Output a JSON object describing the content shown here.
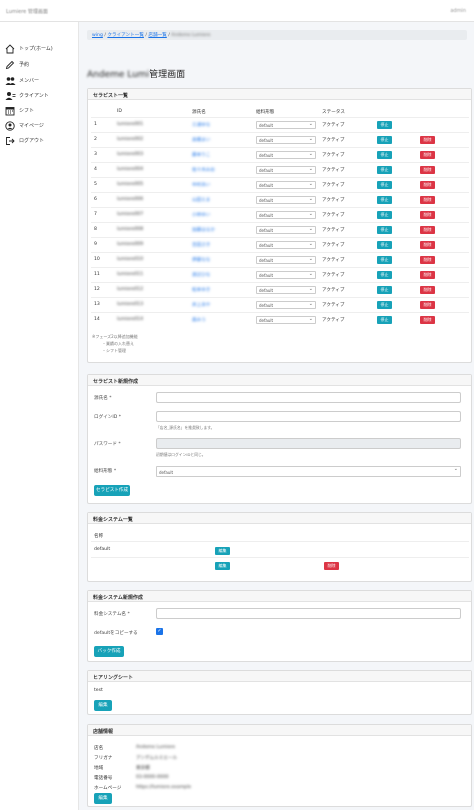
{
  "header": {
    "brand": "Lumiere 管理画面",
    "user": "admin"
  },
  "sidebar": [
    {
      "label": "トップ(ホーム)",
      "icon": "home-icon"
    },
    {
      "label": "予約",
      "icon": "pencil-icon"
    },
    {
      "label": "メンバー",
      "icon": "users-icon"
    },
    {
      "label": "クライアント",
      "icon": "user-card-icon"
    },
    {
      "label": "シフト",
      "icon": "calendar-icon"
    },
    {
      "label": "マイページ",
      "icon": "user-circle-icon"
    },
    {
      "label": "ログアウト",
      "icon": "logout-icon"
    }
  ],
  "breadcrumb": [
    "wing",
    "クライアント一覧",
    "店舗一覧",
    "Andeme Lumiere"
  ],
  "page": {
    "title_blur": "Andeme Lumi",
    "title": "管理画面"
  },
  "therapists": {
    "title": "セラピスト一覧",
    "columns": [
      "ID",
      "源氏名",
      "給料形態",
      "ステータス"
    ],
    "rows": [
      {
        "no": "1",
        "id": "lumiere001",
        "name": "三浦ゆな",
        "pay": "default",
        "status": "アクティブ",
        "has_delete": false
      },
      {
        "no": "2",
        "id": "lumiere002",
        "name": "高橋まい",
        "pay": "default",
        "status": "アクティブ",
        "has_delete": true
      },
      {
        "no": "3",
        "id": "lumiere003",
        "name": "藤本りこ",
        "pay": "default",
        "status": "アクティブ",
        "has_delete": true
      },
      {
        "no": "4",
        "id": "lumiere004",
        "name": "佐々木みお",
        "pay": "default",
        "status": "アクティブ",
        "has_delete": true
      },
      {
        "no": "5",
        "id": "lumiere005",
        "name": "中村あい",
        "pay": "default",
        "status": "アクティブ",
        "has_delete": true
      },
      {
        "no": "6",
        "id": "lumiere006",
        "name": "山田えま",
        "pay": "default",
        "status": "アクティブ",
        "has_delete": true
      },
      {
        "no": "7",
        "id": "lumiere007",
        "name": "小林ゆい",
        "pay": "default",
        "status": "アクティブ",
        "has_delete": true
      },
      {
        "no": "8",
        "id": "lumiere008",
        "name": "加藤はるか",
        "pay": "default",
        "status": "アクティブ",
        "has_delete": true
      },
      {
        "no": "9",
        "id": "lumiere009",
        "name": "吉田さき",
        "pay": "default",
        "status": "アクティブ",
        "has_delete": true
      },
      {
        "no": "10",
        "id": "lumiere010",
        "name": "伊藤なな",
        "pay": "default",
        "status": "アクティブ",
        "has_delete": true
      },
      {
        "no": "11",
        "id": "lumiere011",
        "name": "渡辺ひな",
        "pay": "default",
        "status": "アクティブ",
        "has_delete": true
      },
      {
        "no": "12",
        "id": "lumiere012",
        "name": "松本ゆき",
        "pay": "default",
        "status": "アクティブ",
        "has_delete": true
      },
      {
        "no": "13",
        "id": "lumiere013",
        "name": "井上あや",
        "pay": "default",
        "status": "アクティブ",
        "has_delete": true
      },
      {
        "no": "14",
        "id": "lumiere014",
        "name": "森みう",
        "pay": "default",
        "status": "アクティブ",
        "has_delete": true
      }
    ],
    "stop_label": "停止",
    "delete_label": "削除",
    "notes": [
      "※フェーズ2以降追加機能",
      "・業績の入れ替え",
      "・シフト管理"
    ]
  },
  "new_therapist": {
    "title": "セラピスト新規作成",
    "name_label": "源氏名 *",
    "login_label": "ログインID *",
    "login_hint": "「店名_源氏名」を推奨致します。",
    "password_label": "パスワード *",
    "password_hint": "初期値はログインIDと同じ。",
    "pay_label": "給料形態 *",
    "pay_value": "default",
    "submit": "セラピスト作成"
  },
  "fee_list": {
    "title": "料金システム一覧",
    "col": "名称",
    "rows": [
      {
        "name": "default",
        "edit": "編集",
        "delete": ""
      },
      {
        "name": "",
        "edit": "編集",
        "delete": "削除"
      }
    ]
  },
  "new_fee": {
    "title": "料金システム新規作成",
    "name_label": "料金システム名 *",
    "copy_label": "defaultをコピーする",
    "submit": "バック作成"
  },
  "hearing": {
    "title": "ヒアリングシート",
    "text": "test",
    "edit": "編集"
  },
  "shop": {
    "title": "店舗情報",
    "fields": [
      {
        "label": "店名",
        "value": "Andeme Lumiere"
      },
      {
        "label": "フリガナ",
        "value": "アンデムルミエール"
      },
      {
        "label": "地域",
        "value": "東京都"
      },
      {
        "label": "電話番号",
        "value": "03-0000-0000"
      },
      {
        "label": "ホームページ",
        "value": "https://lumiere.example"
      }
    ],
    "edit": "編集"
  }
}
